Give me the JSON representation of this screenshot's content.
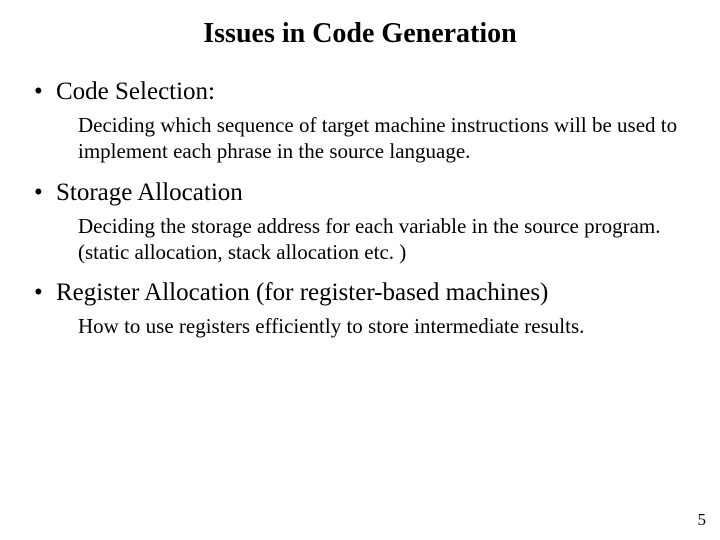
{
  "title": "Issues in Code Generation",
  "items": [
    {
      "heading": "Code Selection:",
      "desc": "Deciding which sequence of target machine instructions will be used to implement each phrase in the source language."
    },
    {
      "heading": "Storage Allocation",
      "desc": "Deciding the storage address for each variable in the source program. (static allocation, stack allocation etc. )"
    },
    {
      "heading": "Register Allocation (for register-based machines)",
      "desc": "How to use registers efficiently to store intermediate results."
    }
  ],
  "page_number": "5"
}
